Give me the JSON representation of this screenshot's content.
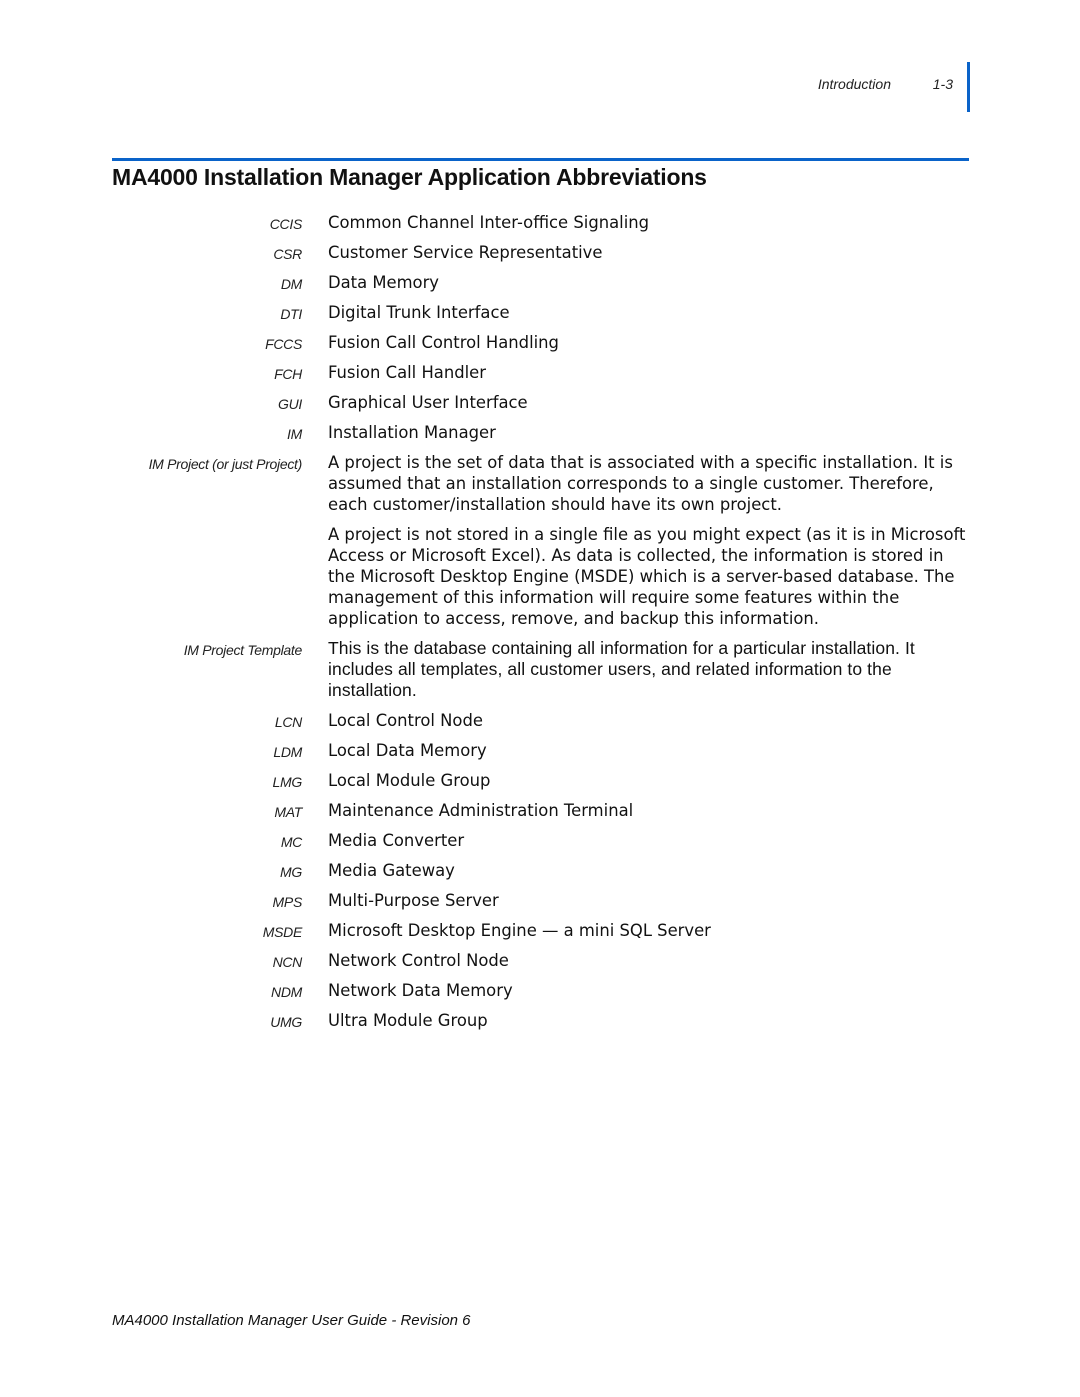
{
  "header": {
    "section": "Introduction",
    "page_number": "1-3",
    "accent_color": "#0a63c9"
  },
  "title": "MA4000 Installation Manager Application Abbreviations",
  "entries": [
    {
      "term": "CCIS",
      "defs": [
        "Common Channel Inter-office Signaling"
      ]
    },
    {
      "term": "CSR",
      "defs": [
        "Customer Service Representative"
      ]
    },
    {
      "term": "DM",
      "defs": [
        "Data Memory"
      ]
    },
    {
      "term": "DTI",
      "defs": [
        "Digital Trunk Interface"
      ]
    },
    {
      "term": "FCCS",
      "defs": [
        "Fusion Call Control Handling"
      ]
    },
    {
      "term": "FCH",
      "defs": [
        "Fusion Call Handler"
      ]
    },
    {
      "term": "GUI",
      "defs": [
        "Graphical User Interface"
      ]
    },
    {
      "term": "IM",
      "defs": [
        "Installation Manager"
      ]
    },
    {
      "term": "IM Project (or just Project)",
      "defs": [
        "A project is the set of data that is associated with a specific installation. It is assumed that an installation corresponds to a single customer. Therefore, each customer/installation should have its own project.",
        "A project is not stored in a single file as you might expect (as it is in Microsoft Access or Microsoft Excel). As data is collected, the information is stored in the Microsoft Desktop Engine (MSDE) which is a server-based database. The management of this information will require some features within the application to access, remove, and backup this information."
      ]
    },
    {
      "term": "IM Project Template",
      "defs": [
        "This is the database containing all information for a particular installation. It includes all templates, all customer users, and related information to the installation."
      ]
    },
    {
      "term": "LCN",
      "defs": [
        "Local Control Node"
      ]
    },
    {
      "term": "LDM",
      "defs": [
        "Local Data Memory"
      ]
    },
    {
      "term": "LMG",
      "defs": [
        "Local Module Group"
      ]
    },
    {
      "term": "MAT",
      "defs": [
        "Maintenance Administration Terminal"
      ]
    },
    {
      "term": "MC",
      "defs": [
        "Media Converter"
      ]
    },
    {
      "term": "MG",
      "defs": [
        "Media Gateway"
      ]
    },
    {
      "term": "MPS",
      "defs": [
        "Multi-Purpose Server"
      ]
    },
    {
      "term": "MSDE",
      "defs": [
        "Microsoft Desktop Engine — a mini SQL Server"
      ]
    },
    {
      "term": "NCN",
      "defs": [
        "Network Control Node"
      ]
    },
    {
      "term": "NDM",
      "defs": [
        "Network Data Memory"
      ]
    },
    {
      "term": "UMG",
      "defs": [
        "Ultra Module Group"
      ]
    }
  ],
  "footer": "MA4000 Installation Manager User Guide - Revision 6"
}
